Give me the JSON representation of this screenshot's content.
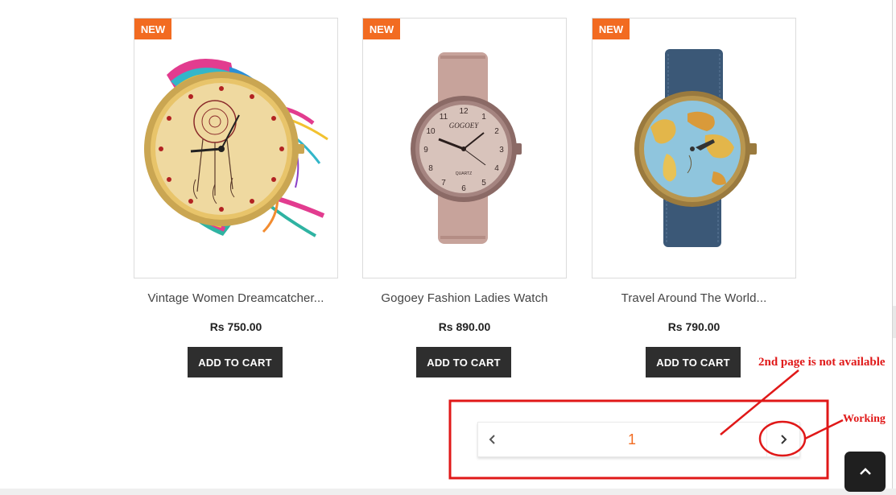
{
  "products": [
    {
      "badge": "NEW",
      "name": "Vintage Women Dreamcatcher...",
      "price": "Rs 750.00",
      "add_to_cart_label": "ADD TO CART",
      "image_alt": "dreamcatcher-watch"
    },
    {
      "badge": "NEW",
      "name": "Gogoey Fashion Ladies Watch",
      "price": "Rs 890.00",
      "add_to_cart_label": "ADD TO CART",
      "image_alt": "gogoey-watch",
      "dial_brand": "GOGOEY",
      "dial_sub": "QUARTZ"
    },
    {
      "badge": "NEW",
      "name": "Travel Around The World...",
      "price": "Rs 790.00",
      "add_to_cart_label": "ADD TO CART",
      "image_alt": "world-map-watch"
    }
  ],
  "pagination": {
    "prev_icon": "chevron-left-icon",
    "current_page": "1",
    "next_icon": "chevron-right-icon"
  },
  "annotations": {
    "not_available": "2nd page is not available",
    "working": "Working",
    "color": "#e01818"
  },
  "back_to_top": {
    "icon": "chevron-up-icon"
  },
  "colors": {
    "accent": "#f26b21",
    "button_dark": "#2e2e2e",
    "annotation": "#e01818"
  }
}
